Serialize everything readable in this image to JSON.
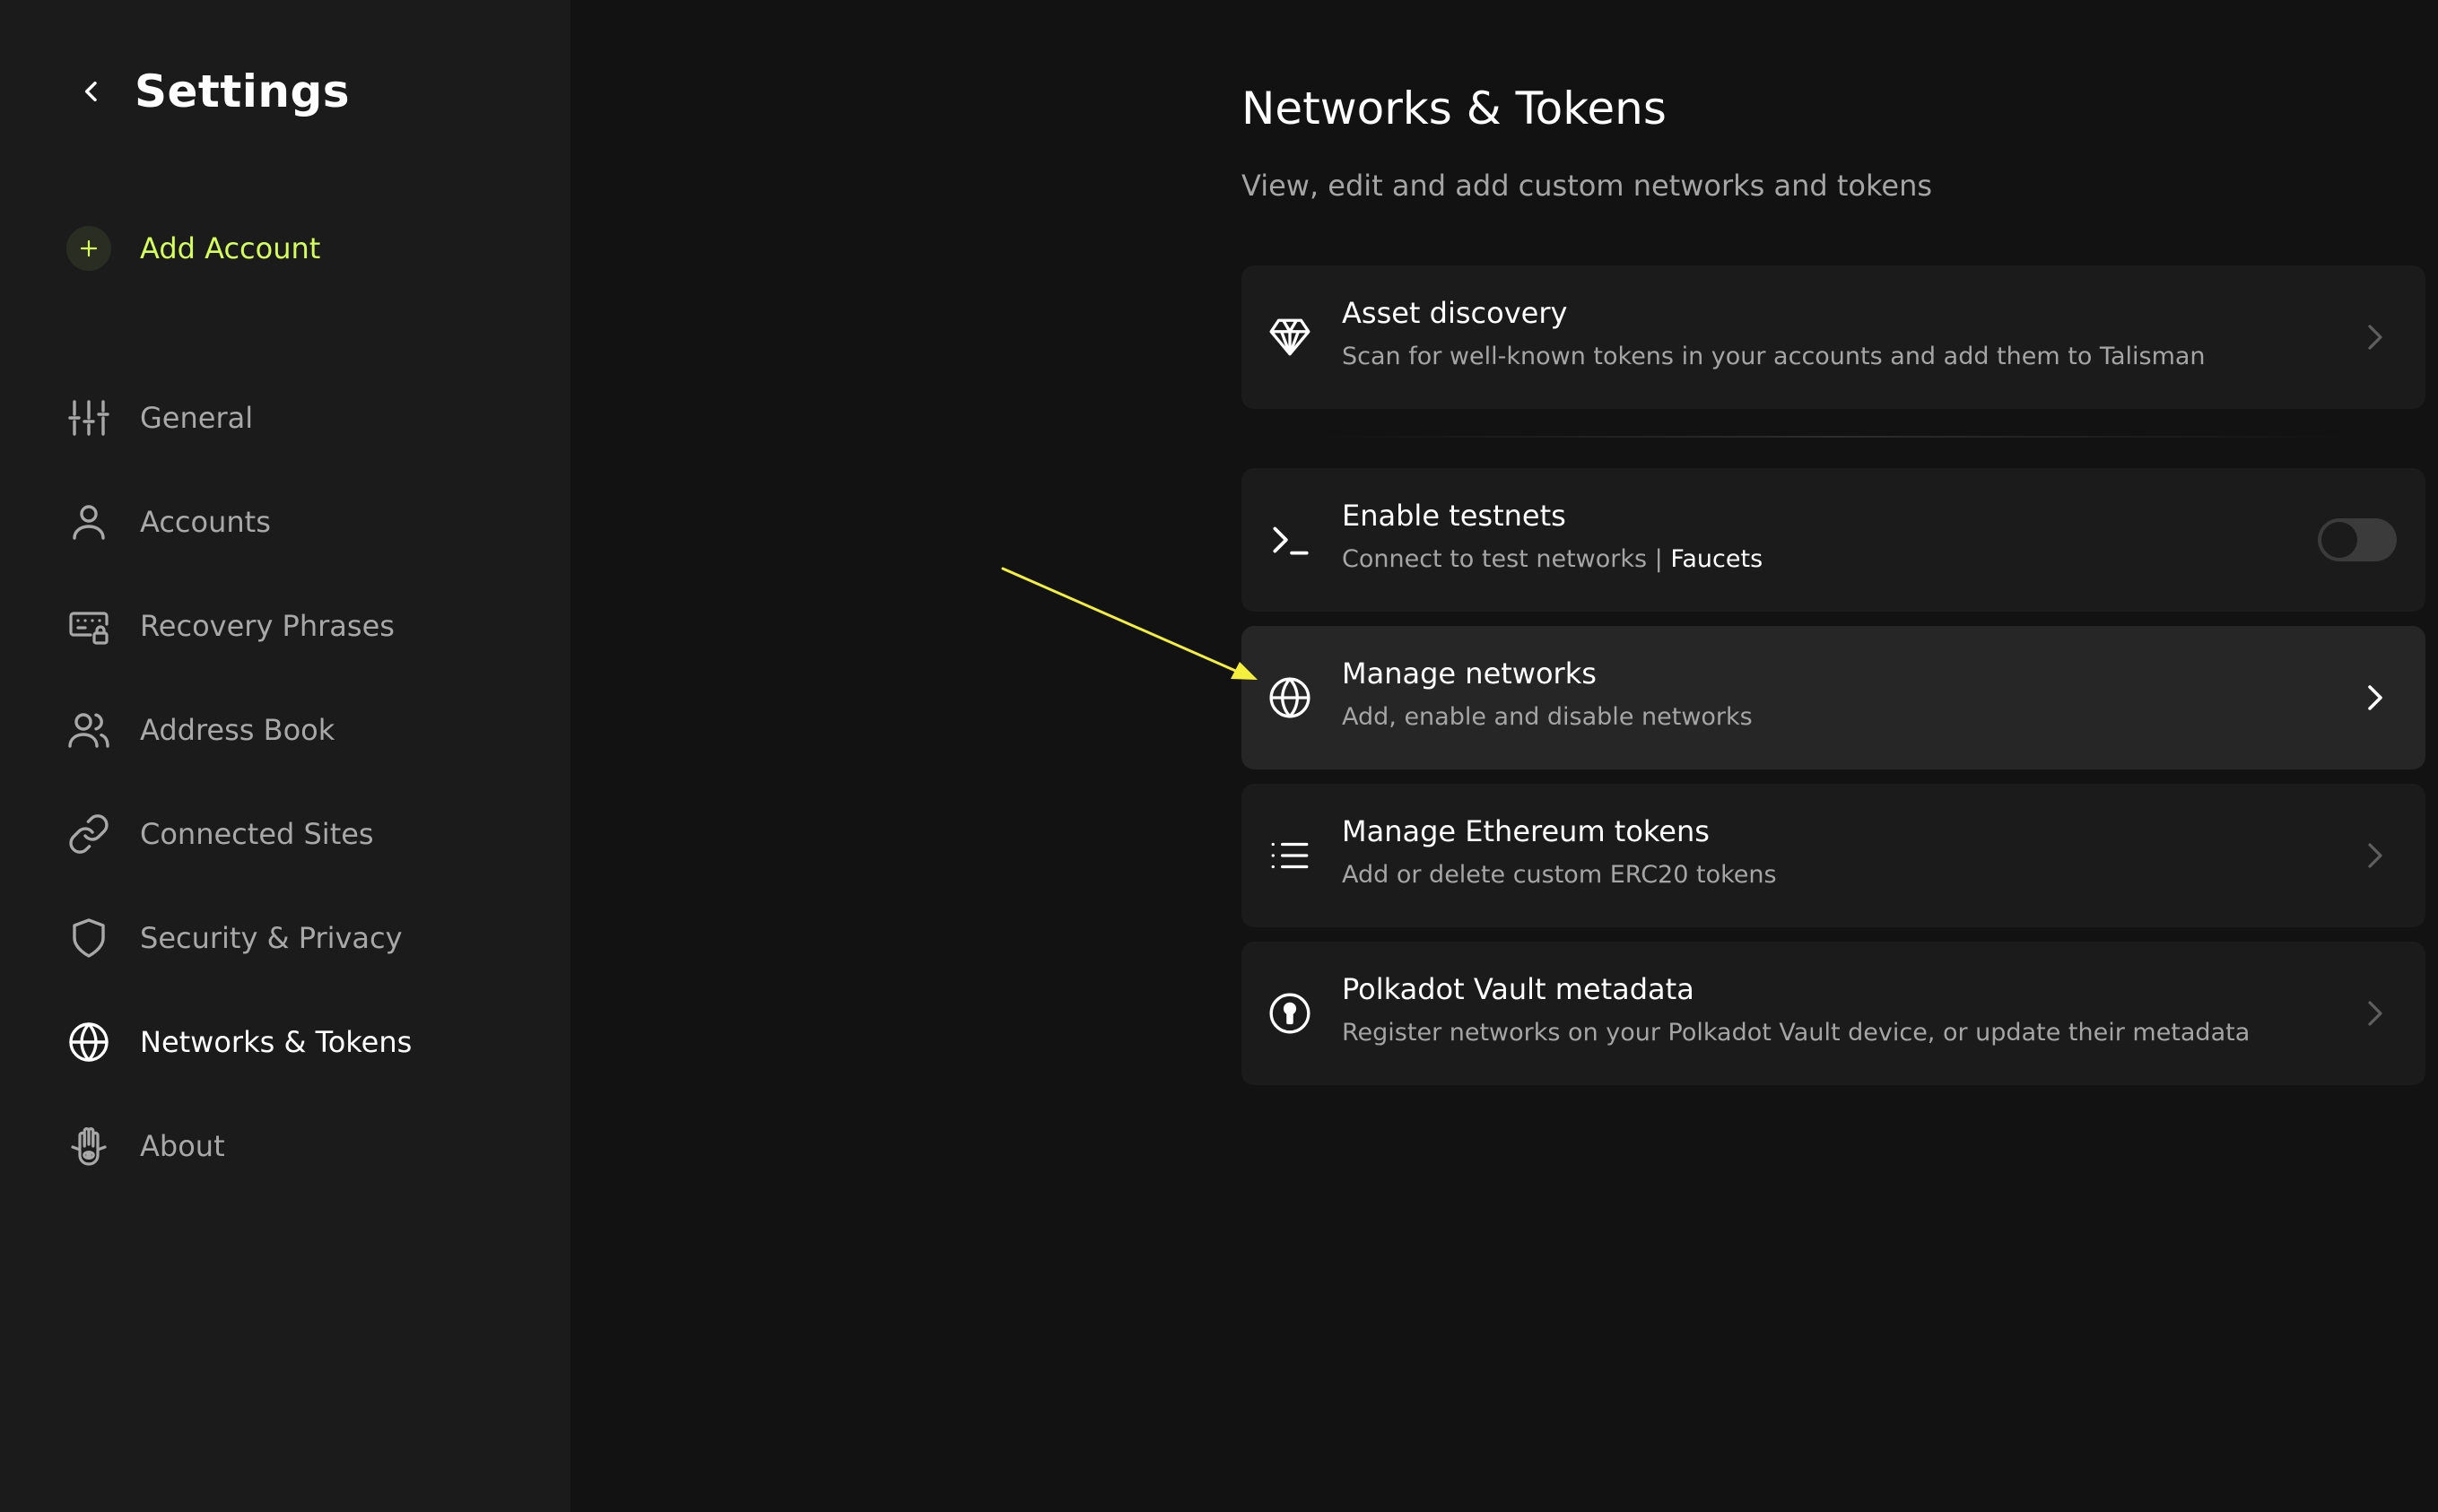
{
  "sidebar": {
    "title": "Settings",
    "add_account_label": "Add Account",
    "items": [
      {
        "label": "General",
        "icon": "sliders-icon"
      },
      {
        "label": "Accounts",
        "icon": "user-icon"
      },
      {
        "label": "Recovery Phrases",
        "icon": "keyboard-lock-icon"
      },
      {
        "label": "Address Book",
        "icon": "users-icon"
      },
      {
        "label": "Connected Sites",
        "icon": "link-icon"
      },
      {
        "label": "Security & Privacy",
        "icon": "shield-icon"
      },
      {
        "label": "Networks & Tokens",
        "icon": "globe-icon",
        "active": true
      },
      {
        "label": "About",
        "icon": "hamsa-hand-icon"
      }
    ]
  },
  "main": {
    "title": "Networks & Tokens",
    "subtitle": "View, edit and add custom networks and tokens",
    "cards": [
      {
        "title": "Asset discovery",
        "description": "Scan for well-known tokens in your accounts and add them to Talisman",
        "icon": "diamond-icon"
      },
      {
        "title": "Enable testnets",
        "description": "Connect to test networks | ",
        "link": "Faucets",
        "icon": "terminal-icon",
        "toggle_on": false
      },
      {
        "title": "Manage networks",
        "description": "Add, enable and disable networks",
        "icon": "globe-icon"
      },
      {
        "title": "Manage Ethereum tokens",
        "description": "Add or delete custom ERC20 tokens",
        "icon": "list-icon"
      },
      {
        "title": "Polkadot Vault metadata",
        "description": "Register networks on your Polkadot Vault device, or update their metadata",
        "icon": "vault-key-icon"
      }
    ]
  },
  "colors": {
    "accent": "#d5ff5c",
    "annotation_arrow": "#f4ef3c",
    "sidebar_bg": "#1b1b1b",
    "main_bg": "#121212"
  }
}
